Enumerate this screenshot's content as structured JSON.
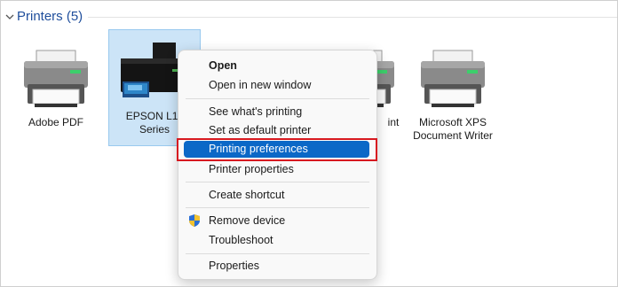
{
  "group": {
    "title": "Printers (5)"
  },
  "devices": [
    {
      "label": "Adobe PDF",
      "icon": "printer-icon"
    },
    {
      "label": "EPSON L11 Series",
      "line1": "EPSON L11",
      "line2": "Series",
      "icon": "epson-printer-icon",
      "selected": true
    },
    {
      "label": "",
      "icon": "printer-icon"
    },
    {
      "label": "int",
      "icon": "printer-icon"
    },
    {
      "label": "Microsoft XPS Document Writer",
      "line1": "Microsoft XPS",
      "line2": "Document Writer",
      "icon": "printer-icon"
    }
  ],
  "context_menu": {
    "items": [
      {
        "label": "Open",
        "bold": true
      },
      {
        "label": "Open in new window"
      },
      {
        "label": "See what's printing"
      },
      {
        "label": "Set as default printer"
      },
      {
        "label": "Printing preferences",
        "highlighted": true
      },
      {
        "label": "Printer properties"
      },
      {
        "label": "Create shortcut"
      },
      {
        "label": "Remove device",
        "icon": "uac-shield-icon"
      },
      {
        "label": "Troubleshoot"
      },
      {
        "label": "Properties"
      }
    ]
  },
  "colors": {
    "accent": "#0b68c7",
    "selection": "#cce4f7",
    "annotation_border": "#d71920",
    "group_title": "#1f4e9c"
  }
}
